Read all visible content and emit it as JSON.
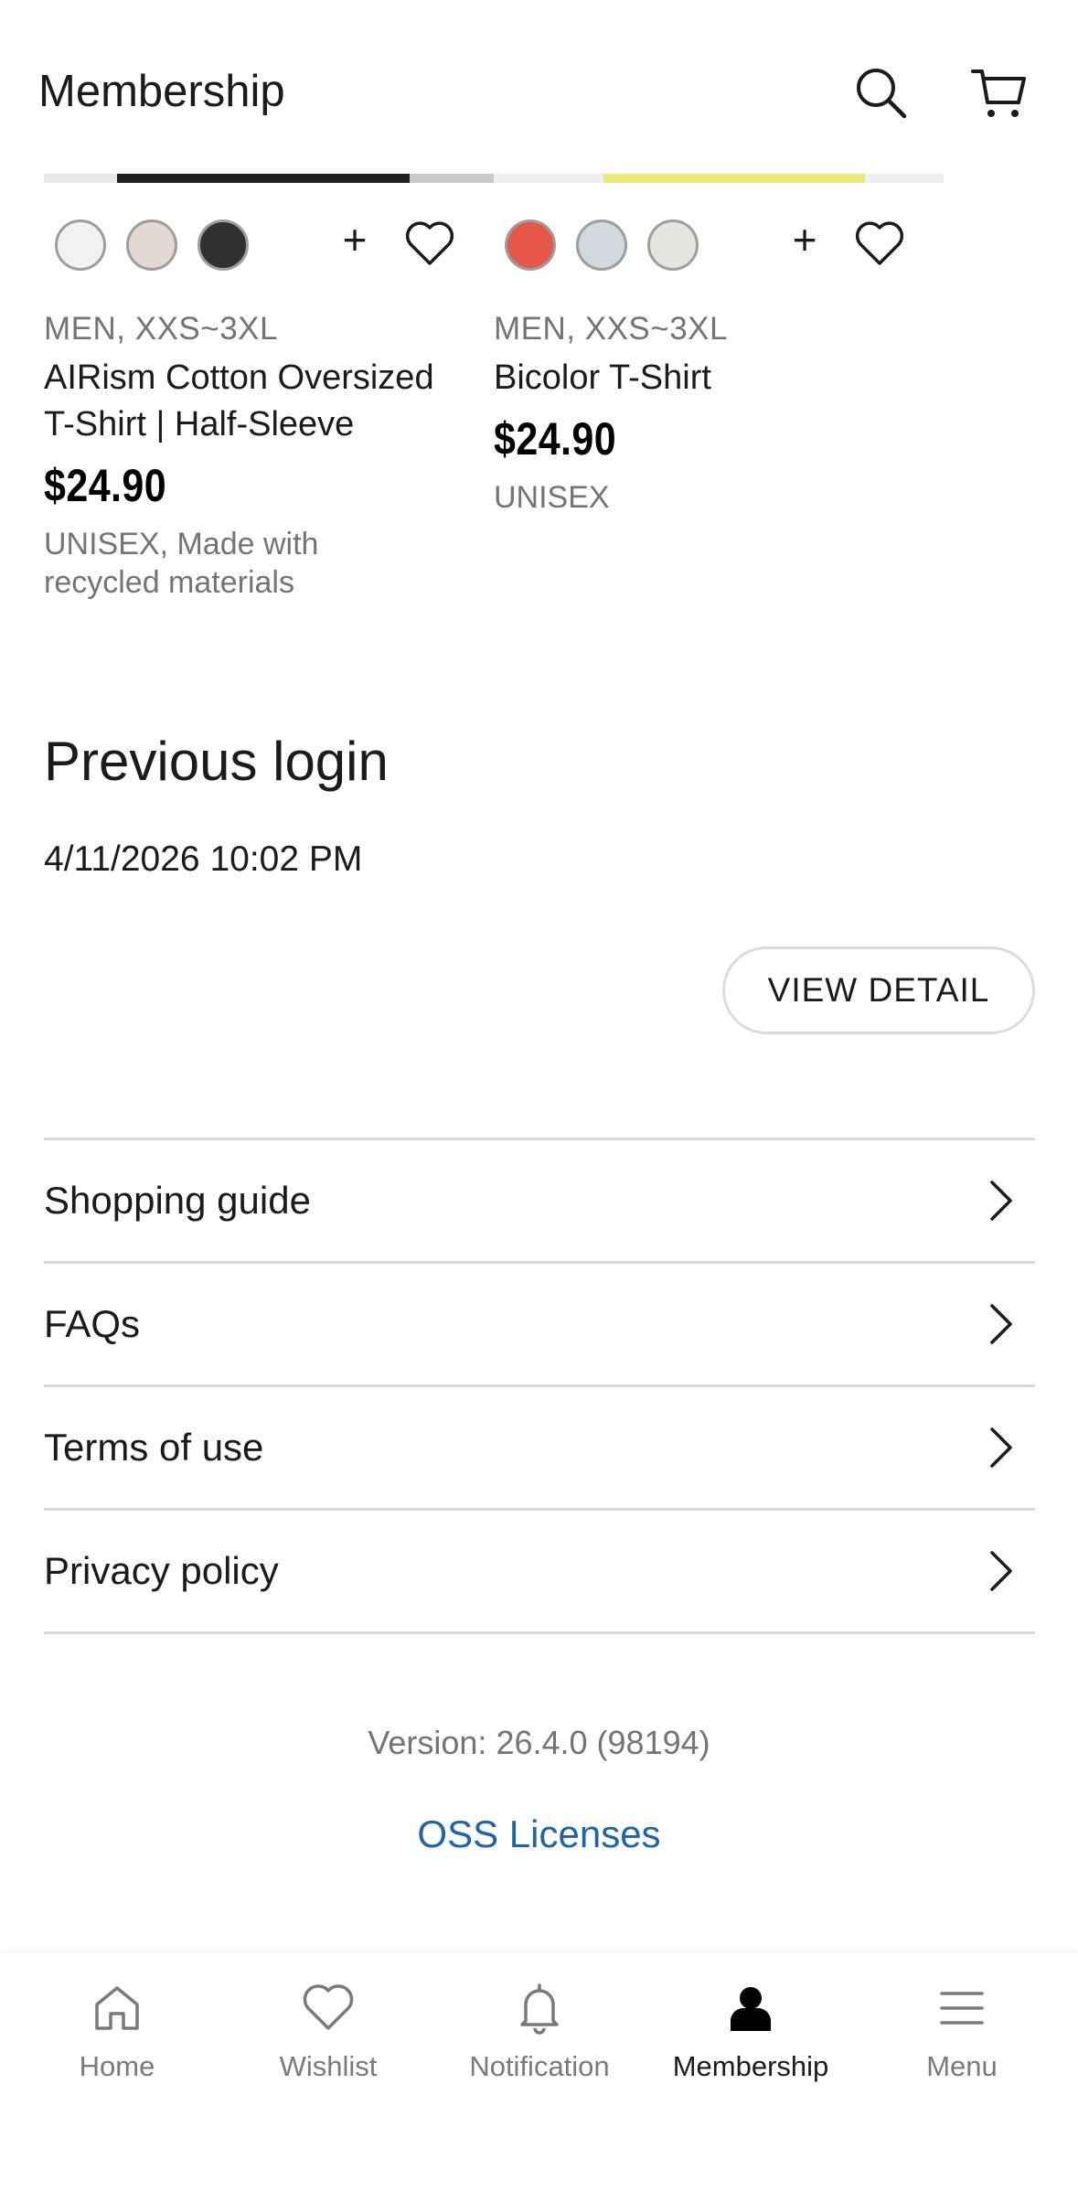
{
  "header": {
    "title": "Membership"
  },
  "products": [
    {
      "swatches": [
        "#f2f2f2",
        "#e3d8d3",
        "#2f3032"
      ],
      "add_label": "+",
      "meta": "MEN, XXS~3XL",
      "name": "AIRism Cotton Oversized T-Shirt | Half-Sleeve",
      "price": "$24.90",
      "tags": "UNISEX, Made with recycled materials"
    },
    {
      "swatches": [
        "#e5584a",
        "#d2d8de",
        "#e3e6e0"
      ],
      "add_label": "+",
      "meta": "MEN, XXS~3XL",
      "name": "Bicolor T-Shirt",
      "price": "$24.90",
      "tags": "UNISEX"
    }
  ],
  "previous_login": {
    "title": "Previous login",
    "datetime": "4/11/2026 10:02 PM",
    "button": "VIEW DETAIL"
  },
  "links": [
    {
      "label": "Shopping guide"
    },
    {
      "label": "FAQs"
    },
    {
      "label": "Terms of use"
    },
    {
      "label": "Privacy policy"
    }
  ],
  "footer": {
    "version": "Version: 26.4.0 (98194)",
    "oss": "OSS Licenses"
  },
  "nav": [
    {
      "label": "Home",
      "icon": "home-icon"
    },
    {
      "label": "Wishlist",
      "icon": "heart-icon"
    },
    {
      "label": "Notification",
      "icon": "bell-icon"
    },
    {
      "label": "Membership",
      "icon": "person-icon",
      "active": true
    },
    {
      "label": "Menu",
      "icon": "menu-icon"
    }
  ],
  "colors": {
    "accent_link": "#1f63a8",
    "text": "#1b1b1b",
    "muted": "#747474",
    "divider": "#dadada"
  }
}
